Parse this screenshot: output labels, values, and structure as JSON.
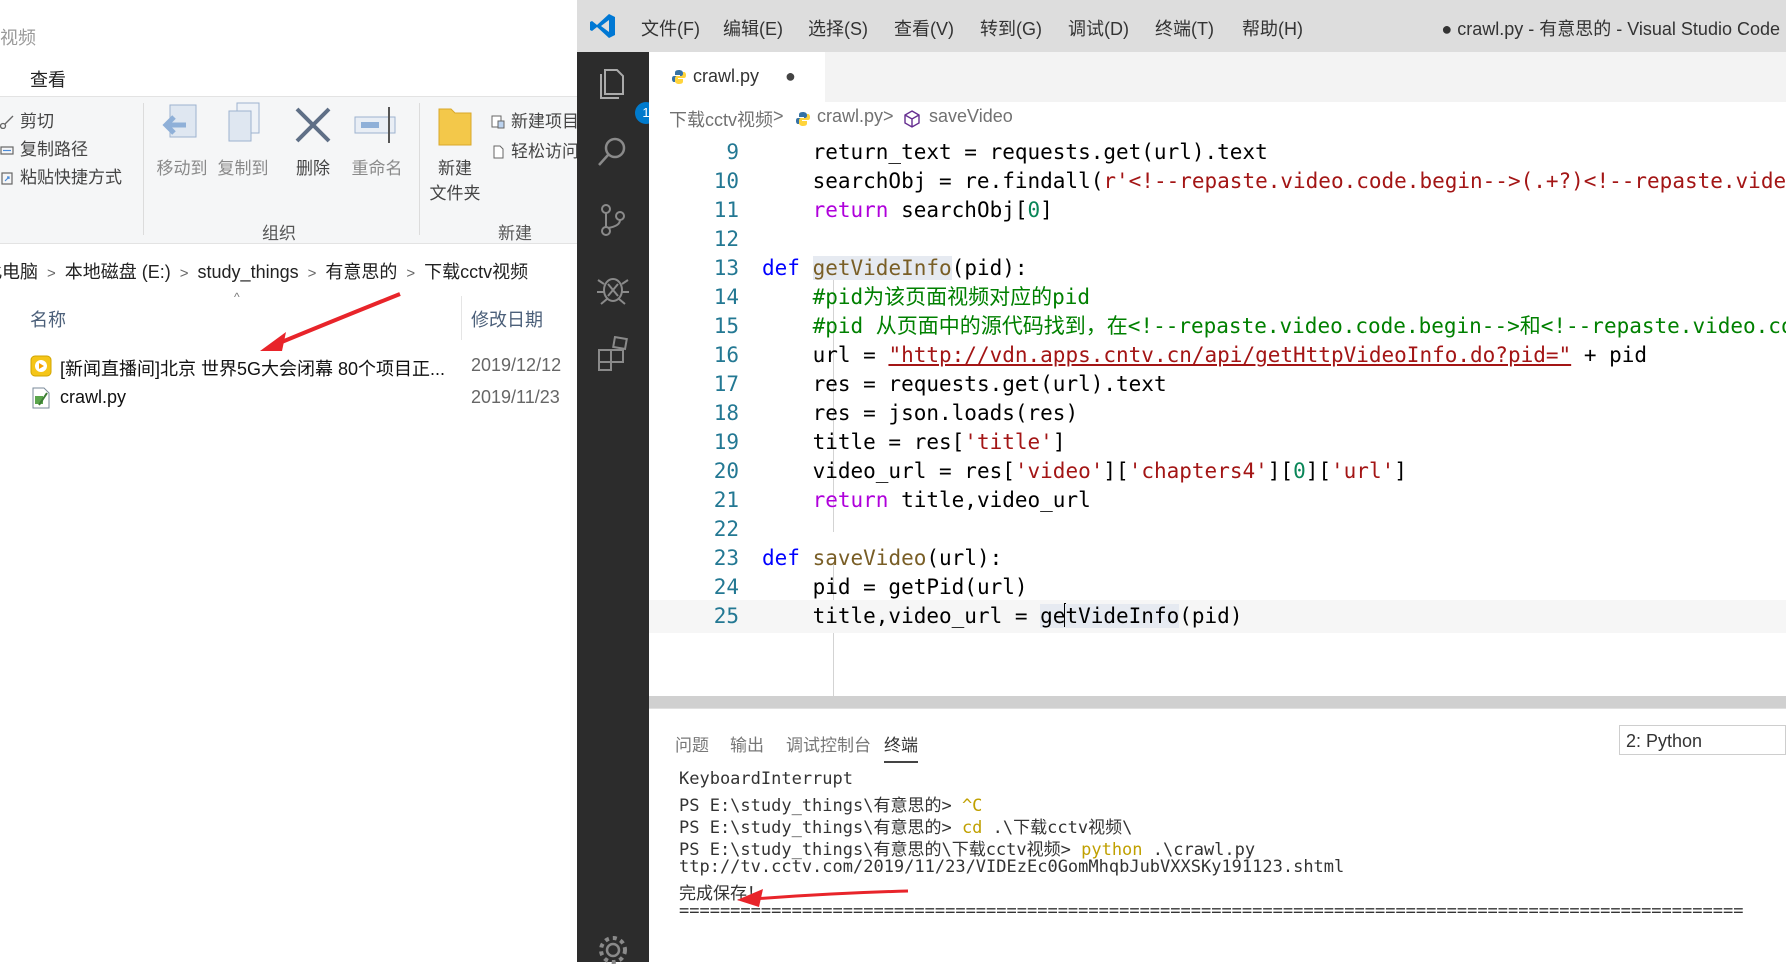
{
  "explorer": {
    "window_title": "视频",
    "menu_tab": "查看",
    "ribbon": {
      "cut": "剪切",
      "copy_path": "复制路径",
      "paste_shortcut": "粘贴快捷方式",
      "move_to": "移动到",
      "copy_to": "复制到",
      "delete": "删除",
      "rename": "重命名",
      "new_folder_line1": "新建",
      "new_folder_line2": "文件夹",
      "new_item": "新建项目",
      "easy_access": "轻松访问",
      "group_organize": "组织",
      "group_new": "新建"
    },
    "address": [
      "此电脑",
      "本地磁盘 (E:)",
      "study_things",
      "有意思的",
      "下载cctv视频"
    ],
    "columns": {
      "name": "名称",
      "date": "修改日期"
    },
    "files": [
      {
        "name": "[新闻直播间]北京 世界5G大会闭幕 80个项目正...",
        "date": "2019/12/12",
        "icon": "video-file-icon"
      },
      {
        "name": "crawl.py",
        "date": "2019/11/23",
        "icon": "python-file-icon"
      }
    ]
  },
  "vscode": {
    "menu": [
      "文件(F)",
      "编辑(E)",
      "选择(S)",
      "查看(V)",
      "转到(G)",
      "调试(D)",
      "终端(T)",
      "帮助(H)"
    ],
    "window_title": "● crawl.py - 有意思的 - Visual Studio Code",
    "explorer_badge": "1",
    "tab": {
      "name": "crawl.py",
      "dirty": "●"
    },
    "breadcrumb": [
      "下载cctv视频",
      "crawl.py",
      "saveVideo"
    ],
    "line_numbers": [
      "9",
      "10",
      "11",
      "12",
      "13",
      "14",
      "15",
      "16",
      "17",
      "18",
      "19",
      "20",
      "21",
      "22",
      "23",
      "24",
      "25"
    ],
    "code": {
      "l9_a": "    return_text = requests.get(url).text",
      "l10_a": "    searchObj = re.findall(",
      "l10_b": "r'<!--repaste.video.code.begin-->(.+?)<!--repaste.video.code.end-->'",
      "l11_kw": "return",
      "l11_a": " searchObj[",
      "l11_n": "0",
      "l11_b": "]",
      "l13_kw": "def",
      "l13_fn": "getVideInfo",
      "l13_a": "(pid):",
      "l14_cm": "#pid为该页面视频对应的pid",
      "l15_cm": "#pid 从页面中的源代码找到，在<!--repaste.video.code.begin-->和<!--repaste.video.code.end-->之间",
      "l16_a": "url = ",
      "l16_st": "\"http://vdn.apps.cntv.cn/api/getHttpVideoInfo.do?pid=\"",
      "l16_b": " + pid",
      "l17_a": "res = requests.get(url).text",
      "l18_a": "res = json.loads(res)",
      "l19_a": "title = res[",
      "l19_st": "'title'",
      "l19_b": "]",
      "l20_a": "video_url = res[",
      "l20_s1": "'video'",
      "l20_b": "][",
      "l20_s2": "'chapters4'",
      "l20_c": "][",
      "l20_n": "0",
      "l20_d": "][",
      "l20_s3": "'url'",
      "l20_e": "]",
      "l21_kw": "return",
      "l21_a": " title,video_url",
      "l23_kw": "def",
      "l23_fn": "saveVideo",
      "l23_a": "(url):",
      "l24_a": "pid = getPid(url)",
      "l25_a": "title,video_url = ",
      "l25_hl1": "ge",
      "l25_hl2": "tVideInfo",
      "l25_b": "(pid)"
    },
    "panel": {
      "tabs": [
        "问题",
        "输出",
        "调试控制台",
        "终端"
      ],
      "terminal_select": "2: Python",
      "terminal": {
        "t1": "KeyboardInterrupt",
        "t2a": "PS E:\\study_things\\有意思的> ",
        "t2b": "^C",
        "t3a": "PS E:\\study_things\\有意思的> ",
        "t3b": "cd",
        "t3c": " .\\下载cctv视频\\",
        "t4a": "PS E:\\study_things\\有意思的\\下载cctv视频> ",
        "t4b": "python",
        "t4c": " .\\crawl.py",
        "t5": "ttp://tv.cctv.com/2019/11/23/VIDEzEc0GomMhqbJubVXXSKy191123.shtml",
        "t6": "完成保存！",
        "t7": "========================================================================================================"
      }
    }
  }
}
